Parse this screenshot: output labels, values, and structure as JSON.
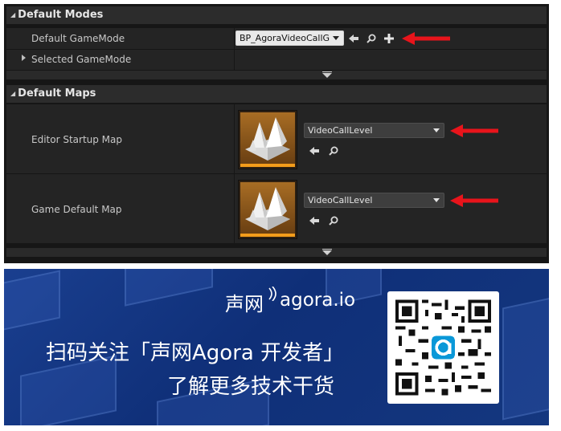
{
  "default_modes": {
    "header": "Default Modes",
    "default_gamemode": {
      "label": "Default GameMode",
      "value": "BP_AgoraVideoCallG"
    },
    "selected_gamemode": {
      "label": "Selected GameMode"
    }
  },
  "default_maps": {
    "header": "Default Maps",
    "editor_startup_map": {
      "label": "Editor Startup Map",
      "value": "VideoCallLevel"
    },
    "game_default_map": {
      "label": "Game Default Map",
      "value": "VideoCallLevel"
    }
  },
  "banner": {
    "logo_cn": "声网",
    "logo_en": "agora.io",
    "line1": "扫码关注「声网Agora 开发者」",
    "line2": "了解更多技术干货"
  },
  "colors": {
    "ue_background": "#161616",
    "ue_row": "#242424",
    "ue_header": "#2c2c2c",
    "annotation_red": "#e8141b",
    "thumbnail_strip": "#f39c1b",
    "banner_blue": "#133a86",
    "agora_accent": "#0a98d8"
  },
  "icons": {
    "browse": "arrow-left-icon",
    "find": "magnifier-icon",
    "add": "plus-icon",
    "expand": "triangle-down-icon",
    "collapsed": "triangle-right-icon",
    "annotation": "red-arrow-icon",
    "map_asset": "level-thumbnail-icon",
    "qr": "qr-code-icon"
  }
}
